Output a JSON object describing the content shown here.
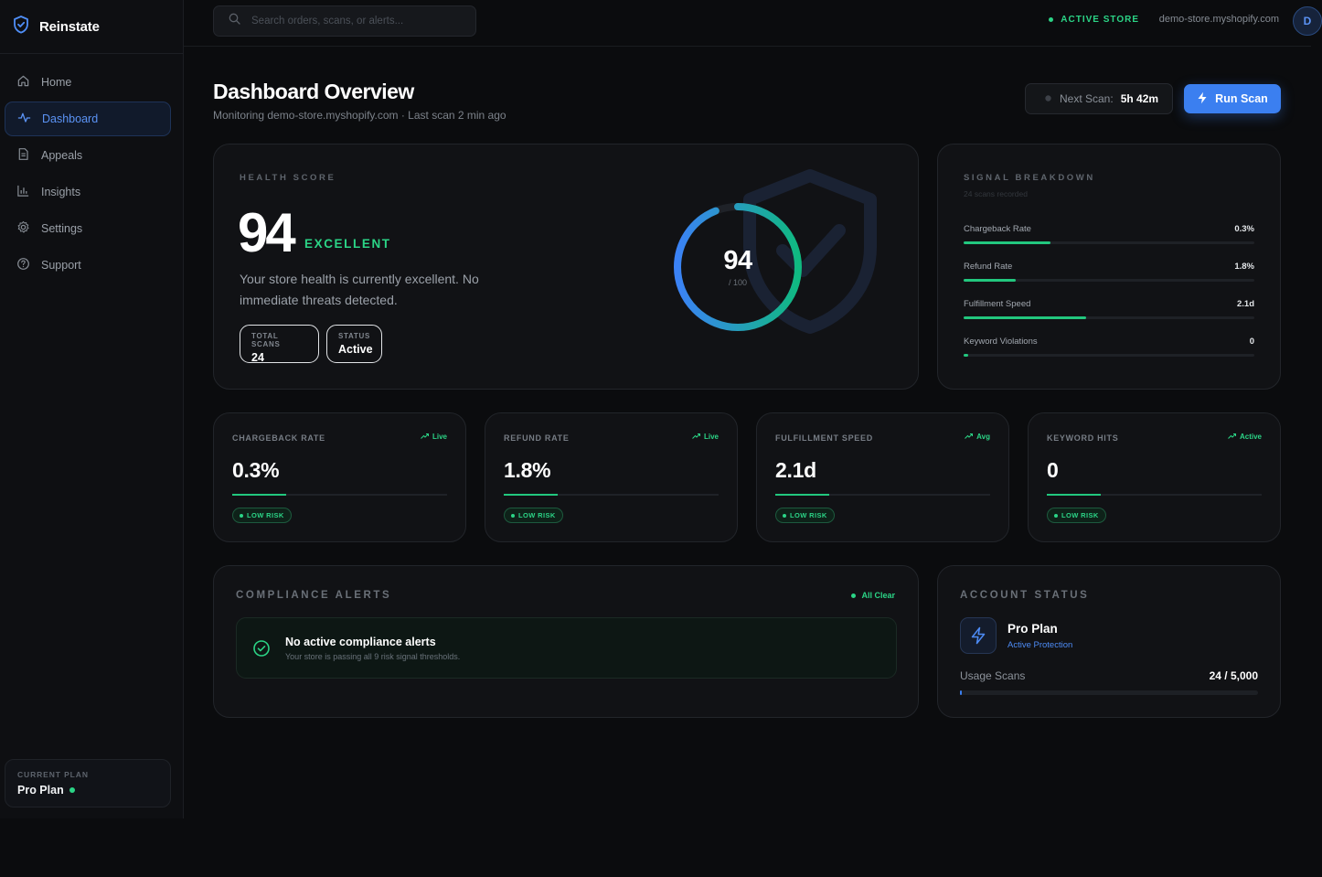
{
  "app": {
    "name": "Reinstate"
  },
  "sidebar": {
    "items": [
      {
        "label": "Home",
        "icon": "home-icon"
      },
      {
        "label": "Dashboard",
        "icon": "activity-icon",
        "active": true
      },
      {
        "label": "Appeals",
        "icon": "document-icon"
      },
      {
        "label": "Insights",
        "icon": "bar-chart-icon"
      },
      {
        "label": "Settings",
        "icon": "gear-icon"
      },
      {
        "label": "Support",
        "icon": "help-circle-icon"
      }
    ],
    "plan": {
      "caption": "CURRENT PLAN",
      "name": "Pro Plan"
    }
  },
  "topbar": {
    "search_placeholder": "Search orders, scans, or alerts...",
    "store_status": "ACTIVE STORE",
    "store_domain": "demo-store.myshopify.com",
    "avatar_initial": "D"
  },
  "header": {
    "title": "Dashboard Overview",
    "subtitle": "Monitoring demo-store.myshopify.com · Last scan 2 min ago",
    "next_scan_label": "Next Scan:",
    "next_scan_value": "5h 42m",
    "run_scan_label": "Run Scan"
  },
  "health": {
    "caption": "HEALTH SCORE",
    "score": "94",
    "grade": "EXCELLENT",
    "description": "Your store health is currently excellent. No immediate threats detected.",
    "total_scans_caption": "TOTAL SCANS",
    "total_scans": "24",
    "status_caption": "STATUS",
    "status": "Active",
    "gauge_value": "94",
    "gauge_max": "/ 100",
    "gauge_fraction": 0.94
  },
  "signals": {
    "caption": "SIGNAL BREAKDOWN",
    "subtitle": "24 scans recorded",
    "rows": [
      {
        "label": "Chargeback Rate",
        "value": "0.3%",
        "level": 0.3
      },
      {
        "label": "Refund Rate",
        "value": "1.8%",
        "level": 0.18
      },
      {
        "label": "Fulfillment Speed",
        "value": "2.1d",
        "level": 0.42
      },
      {
        "label": "Keyword Violations",
        "value": "0",
        "level": 0.015
      }
    ]
  },
  "metrics": [
    {
      "caption": "CHARGEBACK RATE",
      "tag": "Live",
      "value": "0.3%",
      "badge": "LOW RISK",
      "level": 0.25
    },
    {
      "caption": "REFUND RATE",
      "tag": "Live",
      "value": "1.8%",
      "badge": "LOW RISK",
      "level": 0.25
    },
    {
      "caption": "FULFILLMENT SPEED",
      "tag": "Avg",
      "value": "2.1d",
      "badge": "LOW RISK",
      "level": 0.25
    },
    {
      "caption": "KEYWORD HITS",
      "tag": "Active",
      "value": "0",
      "badge": "LOW RISK",
      "level": 0.25
    }
  ],
  "compliance": {
    "caption": "COMPLIANCE ALERTS",
    "tag": "All Clear",
    "alert_title": "No active compliance alerts",
    "alert_desc": "Your store is passing all 9 risk signal thresholds."
  },
  "account": {
    "caption": "ACCOUNT STATUS",
    "plan": "Pro Plan",
    "protection": "Active Protection",
    "usage_label": "Usage Scans",
    "usage_value": "24 / 5,000",
    "usage_fraction": 0.0048
  },
  "colors": {
    "accent_blue": "#3b7ff0",
    "success_green": "#2bd486",
    "background": "#0b0c0e"
  }
}
